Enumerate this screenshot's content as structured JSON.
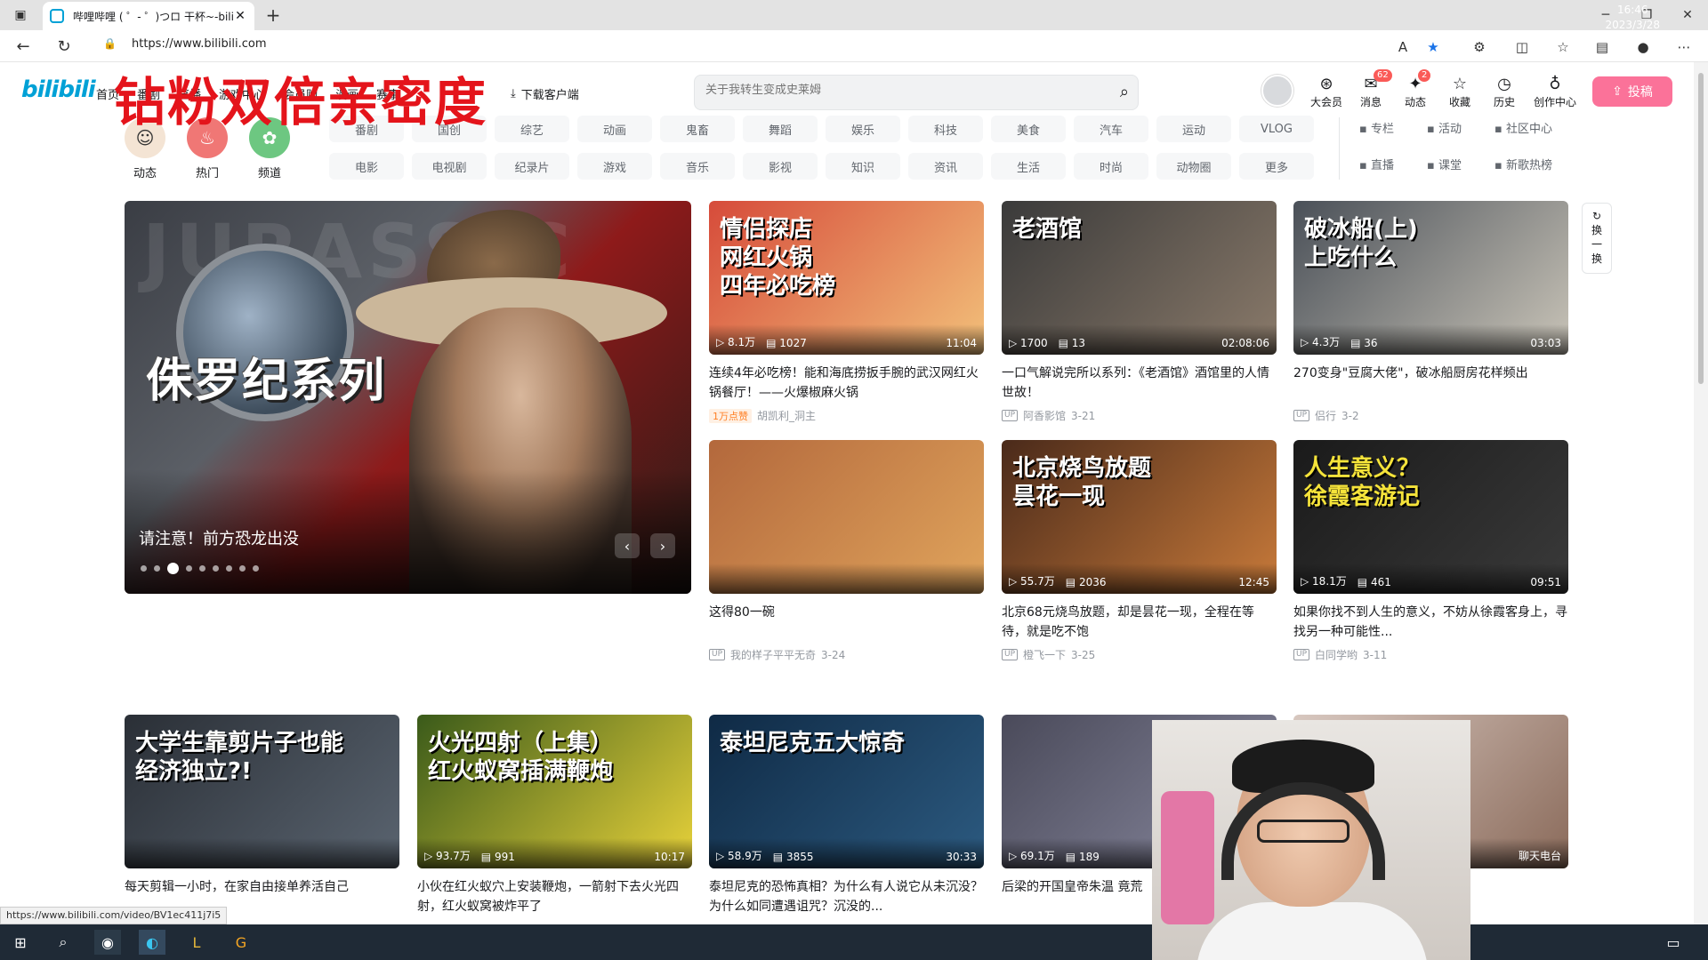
{
  "browser": {
    "tab_title": "哔哩哔哩 ( ゜- ゜)つロ 干杯~-bilibili",
    "url": "https://www.bilibili.com"
  },
  "header": {
    "logo": "bilibili",
    "nav": [
      "首页",
      "番剧",
      "直播",
      "游戏中心",
      "会员购",
      "漫画",
      "赛事"
    ],
    "overlay_title": "钻粉双倍亲密度",
    "download": "下载客户端",
    "search_placeholder": "关于我转生变成史莱姆",
    "items": [
      {
        "label": "大会员",
        "icon": "vip-icon"
      },
      {
        "label": "消息",
        "icon": "message-icon",
        "badge": "62"
      },
      {
        "label": "动态",
        "icon": "dynamic-icon",
        "badge": "2"
      },
      {
        "label": "收藏",
        "icon": "star-icon"
      },
      {
        "label": "历史",
        "icon": "history-icon"
      },
      {
        "label": "创作中心",
        "icon": "creator-icon"
      }
    ],
    "upload": "投稿"
  },
  "quick": [
    {
      "label": "动态"
    },
    {
      "label": "热门"
    },
    {
      "label": "频道"
    }
  ],
  "channels": [
    "番剧",
    "国创",
    "综艺",
    "动画",
    "鬼畜",
    "舞蹈",
    "娱乐",
    "科技",
    "美食",
    "汽车",
    "运动",
    "VLOG",
    "电影",
    "电视剧",
    "纪录片",
    "游戏",
    "音乐",
    "影视",
    "知识",
    "资讯",
    "生活",
    "时尚",
    "动物圈",
    "更多"
  ],
  "side_links": [
    "专栏",
    "活动",
    "社区中心",
    "直播",
    "课堂",
    "新歌热榜"
  ],
  "banner": {
    "watermark": "JURASSIC",
    "series_text": "侏罗纪系列",
    "caption": "请注意！前方恐龙出没",
    "dot_count": 9,
    "active_dot": 3
  },
  "refresh_label": "换一换",
  "cards": [
    {
      "thumb_text": "情侣探店\n网红火锅\n四年必吃榜",
      "views": "8.1万",
      "danmaku": "1027",
      "duration": "11:04",
      "title": "连续4年必吃榜！能和海底捞扳手腕的武汉网红火锅餐厅！——火爆椒麻火锅",
      "hot": "1万点赞",
      "author": "胡凯利_洞主",
      "date": "",
      "colors": [
        "#d64b3a",
        "#f2c07a"
      ]
    },
    {
      "thumb_text": "老酒馆",
      "views": "1700",
      "danmaku": "13",
      "duration": "02:08:06",
      "title": "一口气解说完所以系列：《老酒馆》酒馆里的人情世故！",
      "author": "阿香影馆",
      "date": "3-21",
      "colors": [
        "#3a3a3a",
        "#8a7a6a"
      ]
    },
    {
      "thumb_text": "破冰船(上)\n上吃什么",
      "views": "4.3万",
      "danmaku": "36",
      "duration": "03:03",
      "title": "270变身\"豆腐大佬\"，破冰船厨房花样频出",
      "author": "侣行",
      "date": "3-2",
      "colors": [
        "#4a5058",
        "#c9c4b8"
      ]
    },
    {
      "thumb_text": "",
      "views": "",
      "danmaku": "",
      "duration": "",
      "title": "这得80一碗",
      "author": "我的样子平平无奇",
      "date": "3-24",
      "colors": [
        "#b3683c",
        "#e0a45c"
      ]
    },
    {
      "thumb_text": "北京烧鸟放题\n昙花一现",
      "views": "55.7万",
      "danmaku": "2036",
      "duration": "12:45",
      "title": "北京68元烧鸟放题，却是昙花一现，全程在等待，就是吃不饱",
      "author": "橙飞一下",
      "date": "3-25",
      "colors": [
        "#4a2a1a",
        "#c87a3a"
      ]
    },
    {
      "thumb_text": "人生意义？\n徐霞客游记",
      "views": "18.1万",
      "danmaku": "461",
      "duration": "09:51",
      "title": "如果你找不到人生的意义，不妨从徐霞客身上，寻找另一种可能性...",
      "author": "白同学哟",
      "date": "3-11",
      "colors": [
        "#1a1a1a",
        "#3a3a3a"
      ]
    },
    {
      "thumb_text": "大学生靠剪片子也能\n经济独立?!",
      "views": "",
      "danmaku": "",
      "duration": "",
      "title": "每天剪辑一小时，在家自由接单养活自己",
      "author": "",
      "date": "",
      "colors": [
        "#2a2f36",
        "#5a6470"
      ]
    },
    {
      "thumb_text": "火光四射（上集）\n红火蚁窝插满鞭炮",
      "views": "93.7万",
      "danmaku": "991",
      "duration": "10:17",
      "title": "小伙在红火蚁穴上安装鞭炮，一箭射下去火光四射，红火蚁窝被炸平了",
      "author": "",
      "date": "",
      "colors": [
        "#3a5a1a",
        "#e8d23a"
      ]
    },
    {
      "thumb_text": "泰坦尼克五大惊奇",
      "views": "58.9万",
      "danmaku": "3855",
      "duration": "30:33",
      "title": "泰坦尼克的恐怖真相？为什么有人说它从未沉没？为什么如同遭遇诅咒？沉没的...",
      "author": "",
      "date": "",
      "colors": [
        "#0f2a45",
        "#2c5a80"
      ]
    },
    {
      "thumb_text": "",
      "views": "69.1万",
      "danmaku": "189",
      "duration": "",
      "title": "后梁的开国皇帝朱温 竟荒",
      "author": "",
      "date": "",
      "colors": [
        "#4a4a5a",
        "#8a8aa0"
      ]
    },
    {
      "thumb_text": "",
      "views": "",
      "danmaku": "",
      "duration": "聊天电台",
      "title": "",
      "author": "",
      "date": "",
      "colors": [
        "#d8c8c0",
        "#8a6a5a"
      ]
    }
  ],
  "status_url": "https://www.bilibili.com/video/BV1ec411j7i5",
  "clock": {
    "time": "16:46",
    "date": "2023/3/28"
  }
}
